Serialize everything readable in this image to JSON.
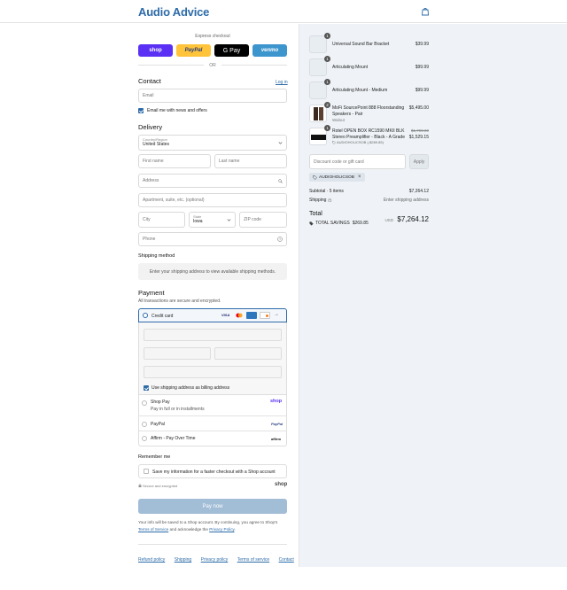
{
  "header": {
    "logo": "Audio Advice",
    "cart_icon": "bag-icon"
  },
  "express": {
    "title": "Express checkout",
    "buttons": [
      {
        "label": "shop",
        "bg": "#5a31f4",
        "color": "#ffffff"
      },
      {
        "label": "PayPal",
        "bg": "#ffc439",
        "color": "#253b80"
      },
      {
        "label": "G Pay",
        "bg": "#000000",
        "color": "#ffffff"
      },
      {
        "label": "venmo",
        "bg": "#3d95ce",
        "color": "#ffffff"
      }
    ],
    "or": "OR"
  },
  "contact": {
    "title": "Contact",
    "login": "Log in",
    "email_placeholder": "Email",
    "newsletter": "Email me with news and offers"
  },
  "delivery": {
    "title": "Delivery",
    "country_label": "Country/Region",
    "country_value": "United States",
    "first_name": "First name",
    "last_name": "Last name",
    "address": "Address",
    "apartment": "Apartment, suite, etc. (optional)",
    "city": "City",
    "state_label": "State",
    "state_value": "Iowa",
    "zip": "ZIP code",
    "phone": "Phone"
  },
  "shipping": {
    "title": "Shipping method",
    "message": "Enter your shipping address to view available shipping methods."
  },
  "payment": {
    "title": "Payment",
    "subtitle": "All transactions are secure and encrypted.",
    "credit_card": "Credit card",
    "billing": "Use shipping address as billing address",
    "shop_pay": "Shop Pay",
    "shop_pay_sub": "Pay in full or in installments",
    "shop_pay_logo": "shop",
    "paypal": "PayPal",
    "paypal_logo": "PayPal",
    "affirm": "Affirm - Pay Over Time",
    "affirm_logo": "affirm"
  },
  "remember": {
    "title": "Remember me",
    "save": "Save my information for a faster checkout with a Shop account",
    "secure": "Secure and encrypted",
    "shop_logo": "shop"
  },
  "pay_now": "Pay now",
  "disclaimer": {
    "line1": "Your info will be saved to a Shop account. By continuing, you agree to Shop's",
    "terms": "Terms of Service",
    "mid": "and acknowledge the",
    "privacy": "Privacy Policy",
    "end": "."
  },
  "footer": [
    "Refund policy",
    "Shipping",
    "Privacy policy",
    "Terms of service",
    "Contact"
  ],
  "cart": {
    "items": [
      {
        "qty": "1",
        "name": "Universal Sound Bar Bracket",
        "sub": "",
        "price": "$39.99",
        "old": "",
        "discount": ""
      },
      {
        "qty": "1",
        "name": "Articulating Mount",
        "sub": "",
        "price": "$99.99",
        "old": "",
        "discount": ""
      },
      {
        "qty": "1",
        "name": "Articulating Mount - Medium",
        "sub": "",
        "price": "$99.99",
        "old": "",
        "discount": ""
      },
      {
        "qty": "2",
        "name": "MoFi SourcePoint 888 Floorstanding Speakers - Pair",
        "sub": "Walnut",
        "price": "$5,495.00",
        "old": "",
        "discount": ""
      },
      {
        "qty": "1",
        "name": "Rotel OPEN BOX RC1590 MKII BLK Stereo Preamplifier - Black - A Grade",
        "sub": "",
        "price": "$1,529.15",
        "old": "$1,799.00",
        "discount": "AUDIOHOLICSOB (-$269.85)"
      }
    ],
    "discount_placeholder": "Discount code or gift card",
    "apply": "Apply",
    "code_tag": "AUDIOHOLICSOB",
    "subtotal_label": "Subtotal · 5 items",
    "subtotal_value": "$7,264.12",
    "shipping_label": "Shipping",
    "shipping_value": "Enter shipping address",
    "total_label": "Total",
    "currency": "USD",
    "total_value": "$7,264.12",
    "savings_label": "TOTAL SAVINGS",
    "savings_value": "$269.85"
  }
}
